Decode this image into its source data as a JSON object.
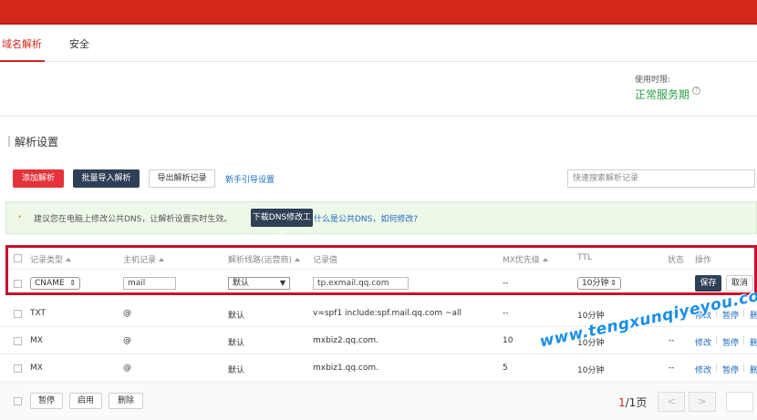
{
  "tabs": [
    {
      "label": "域名解析"
    },
    {
      "label": "安全"
    }
  ],
  "usage": {
    "label": "使用时限:",
    "status": "正常服务期",
    "help_icon": "?"
  },
  "section_title": "解析设置",
  "toolbar": {
    "add_record": "添加解析",
    "batch_import": "批量导入解析",
    "export_records": "导出解析记录",
    "guide_link": "新手引导设置",
    "search_placeholder": "快速搜索解析记录"
  },
  "notice": {
    "bullet": "•",
    "text": "建议您在电脑上修改公共DNS，让解析设置实时生效。",
    "download_button": "下载DNS修改工具",
    "link": "什么是公共DNS，如何修改?"
  },
  "table": {
    "headers": {
      "type": "记录类型",
      "host": "主机记录",
      "line": "解析线路(运营商)",
      "value": "记录值",
      "mx": "MX优先级",
      "ttl": "TTL",
      "status": "状态",
      "actions": "操作"
    },
    "edit_row": {
      "type": "CNAME",
      "host": "mail",
      "line": "默认",
      "value": "tp.exmail.qq.com",
      "mx": "--",
      "ttl": "10分钟",
      "save": "保存",
      "cancel": "取消"
    },
    "rows": [
      {
        "type": "TXT",
        "host": "@",
        "line": "默认",
        "value": "v=spf1 include:spf.mail.qq.com ~all",
        "mx": "--",
        "ttl": "10分钟",
        "status": "--",
        "modify": "修改",
        "pause": "暂停",
        "delete": "删"
      },
      {
        "type": "MX",
        "host": "@",
        "line": "默认",
        "value": "mxbiz2.qq.com.",
        "mx": "10",
        "ttl": "10分钟",
        "status": "--",
        "modify": "修改",
        "pause": "暂停",
        "delete": "删"
      },
      {
        "type": "MX",
        "host": "@",
        "line": "默认",
        "value": "mxbiz1.qq.com.",
        "mx": "5",
        "ttl": "10分钟",
        "status": "--",
        "modify": "修改",
        "pause": "暂停",
        "delete": "删"
      }
    ],
    "separator": "|"
  },
  "footer": {
    "pause": "暂停",
    "enable": "启用",
    "delete": "删除",
    "page_current": "1",
    "page_total": "/1页",
    "prev": "<",
    "next": ">"
  },
  "watermark": "www.tengxunqiyeyou.com",
  "colors": {
    "brand_red": "#d4271b",
    "link_blue": "#1f6bbf",
    "status_green": "#2ba245",
    "highlight_red": "#c8102e"
  }
}
